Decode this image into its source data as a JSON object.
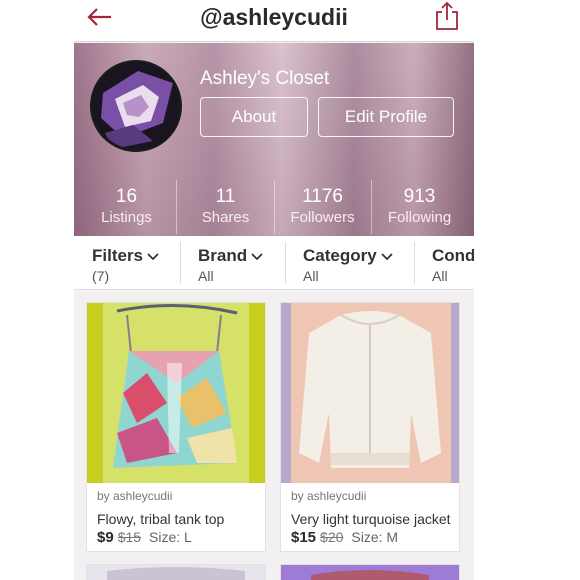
{
  "nav": {
    "username": "@ashleycudii",
    "back_icon": "back-arrow-icon",
    "share_icon": "share-icon"
  },
  "profile": {
    "closet_name": "Ashley's Closet",
    "about_label": "About",
    "edit_label": "Edit Profile"
  },
  "stats": [
    {
      "value": "16",
      "label": "Listings"
    },
    {
      "value": "11",
      "label": "Shares"
    },
    {
      "value": "1176",
      "label": "Followers"
    },
    {
      "value": "913",
      "label": "Following"
    }
  ],
  "filters": [
    {
      "name": "Filters",
      "value": "(7)"
    },
    {
      "name": "Brand",
      "value": "All"
    },
    {
      "name": "Category",
      "value": "All"
    },
    {
      "name": "Cond",
      "value": "All"
    }
  ],
  "listings": [
    {
      "by": "by ashleycudii",
      "title": "Flowy, tribal tank top",
      "price": "$9",
      "original_price": "$15",
      "size": "Size: L"
    },
    {
      "by": "by ashleycudii",
      "title": "Very light turquoise jacket",
      "price": "$15",
      "original_price": "$20",
      "size": "Size: M"
    }
  ],
  "colors": {
    "accent": "#a3243b",
    "hero_tint": "#b38fa3"
  }
}
